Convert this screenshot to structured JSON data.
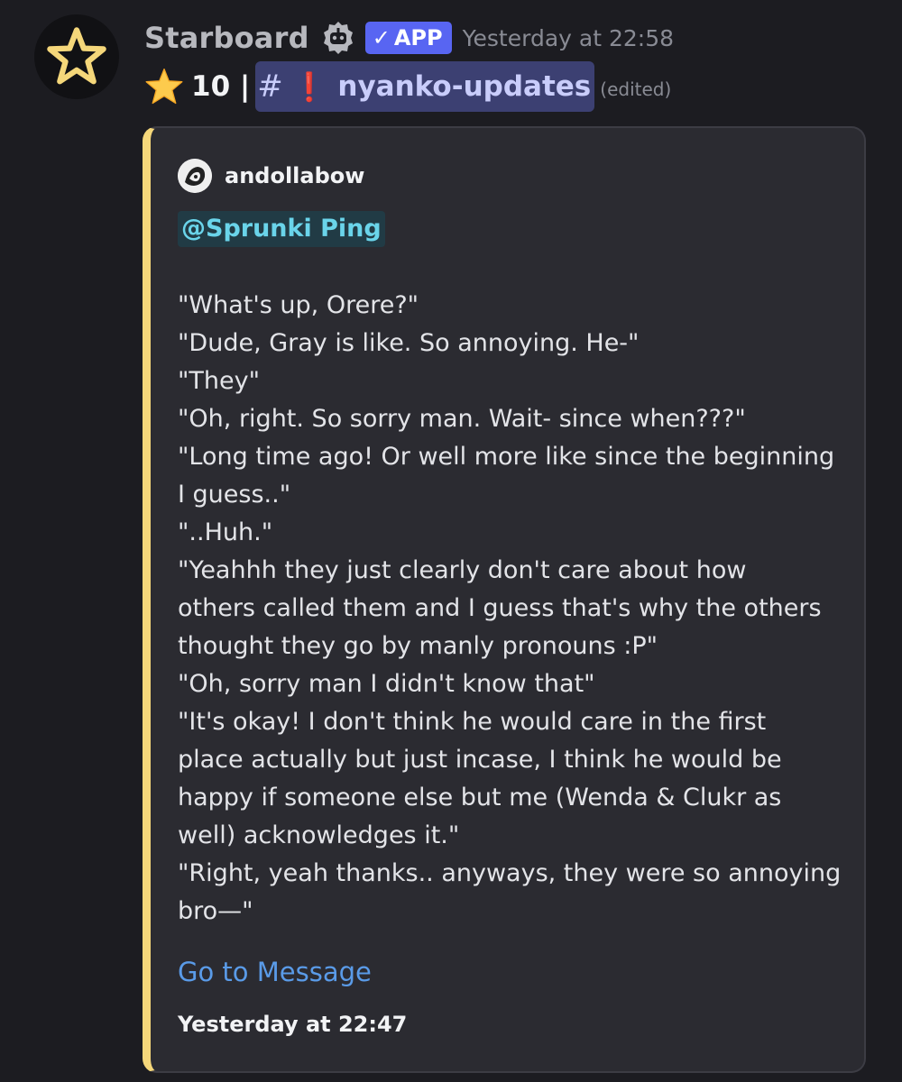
{
  "message": {
    "author_name": "Starboard",
    "bot_icon": "robot-icon",
    "app_badge": {
      "check": "✓",
      "label": "APP",
      "color": "#5865f2"
    },
    "timestamp": "Yesterday at 22:58",
    "content": {
      "star_icon": "star-emoji-icon",
      "star_count": "10 |",
      "channel": {
        "hash": "#",
        "emoji": "❗",
        "name": "nyanko-updates"
      },
      "edited": "(edited)"
    }
  },
  "embed": {
    "accent_color": "#f5d77a",
    "author": {
      "avatar_icon": "author-avatar-icon",
      "name": "andollabow"
    },
    "role_mention": "@Sprunki Ping",
    "lines": [
      "\"What's up, Orere?\"",
      "\"Dude, Gray is like. So annoying. He-\"",
      "\"They\"",
      "\"Oh, right. So sorry man. Wait- since when???\"",
      "\"Long time ago! Or well more like since the beginning",
      "I guess..\"",
      "\"..Huh.\"",
      "\"Yeahhh they just clearly don't care about how",
      "others called them and I guess that's why the others",
      "thought they go by manly pronouns :P\"",
      "\"Oh, sorry man I didn't know that\"",
      "\"It's okay! I don't think he would care in the first",
      "place actually but just incase, I think he would be",
      "happy if someone else but me (Wenda & Clukr as",
      "well) acknowledges it.\"",
      "\"Right, yeah thanks.. anyways, they were so annoying",
      "bro—\""
    ],
    "go_to_message": "Go to Message",
    "footer_timestamp": "Yesterday at 22:47"
  }
}
